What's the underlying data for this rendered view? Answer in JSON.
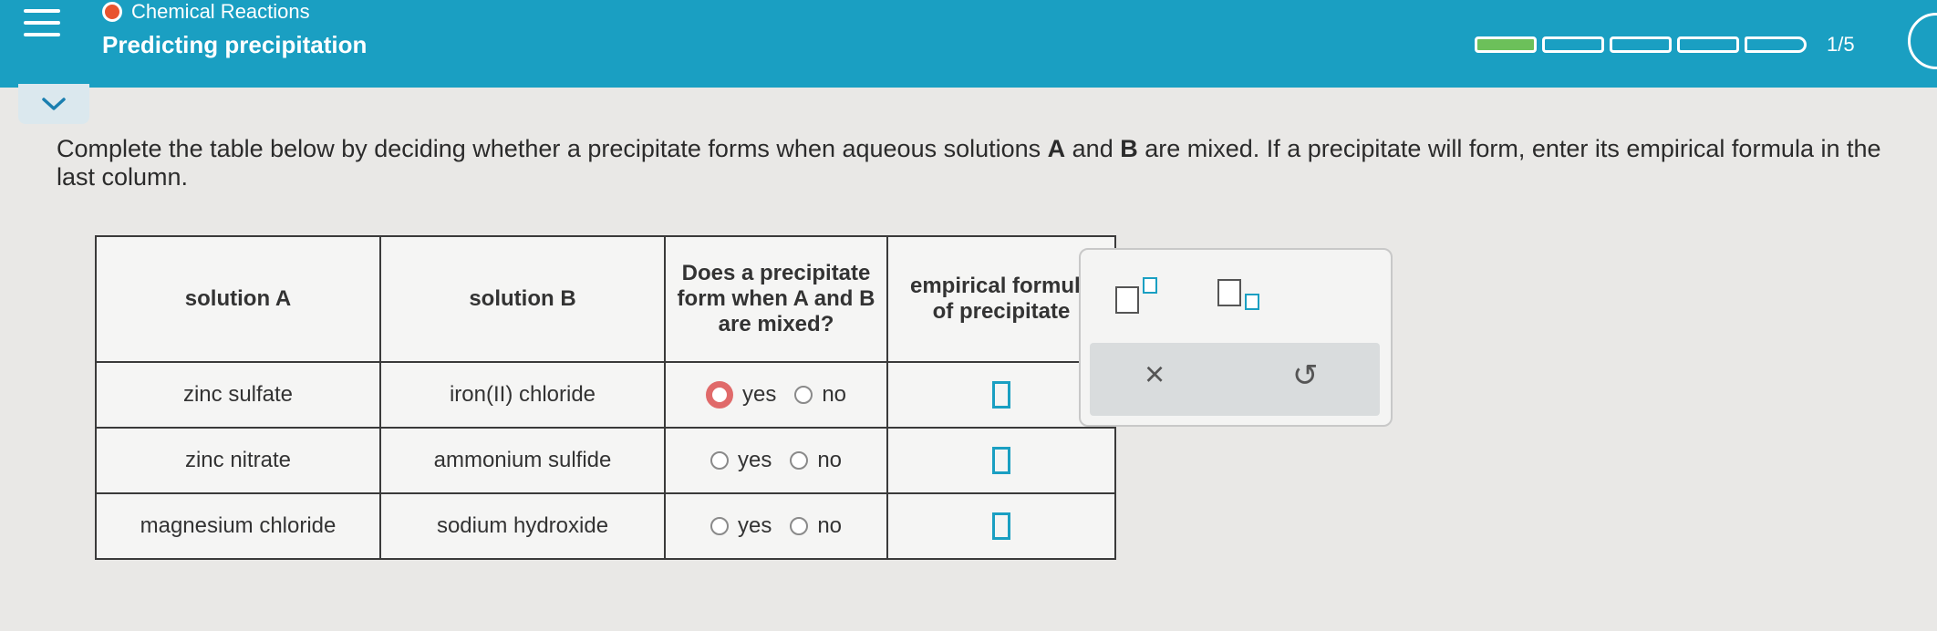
{
  "header": {
    "topic": "Chemical Reactions",
    "title": "Predicting precipitation",
    "progress_text": "1/5",
    "progress_fraction": 0.2,
    "colors": {
      "bar": "#1a9fc2",
      "progress_fill": "#6cc05a",
      "topic_dot": "#e8542f"
    }
  },
  "instructions": {
    "part1": "Complete the table below by deciding whether a precipitate forms when aqueous solutions ",
    "a": "A",
    "and": " and ",
    "b": "B",
    "part2": " are mixed. If a precipitate will form, enter its empirical formula in the last column."
  },
  "table": {
    "headers": [
      "solution A",
      "solution B",
      "Does a precipitate form when A and B are mixed?",
      "empirical formula of precipitate"
    ],
    "rows": [
      {
        "solution_a": "zinc sulfate",
        "solution_b": "iron(II) chloride",
        "yes": "yes",
        "no": "no"
      },
      {
        "solution_a": "zinc nitrate",
        "solution_b": "ammonium sulfide",
        "yes": "yes",
        "no": "no"
      },
      {
        "solution_a": "magnesium chloride",
        "solution_b": "sodium hydroxide",
        "yes": "yes",
        "no": "no"
      }
    ]
  },
  "palette": {
    "icons": [
      "superscript-icon",
      "subscript-icon",
      "clear-icon",
      "undo-icon"
    ],
    "clear_glyph": "×",
    "undo_glyph": "↺"
  }
}
